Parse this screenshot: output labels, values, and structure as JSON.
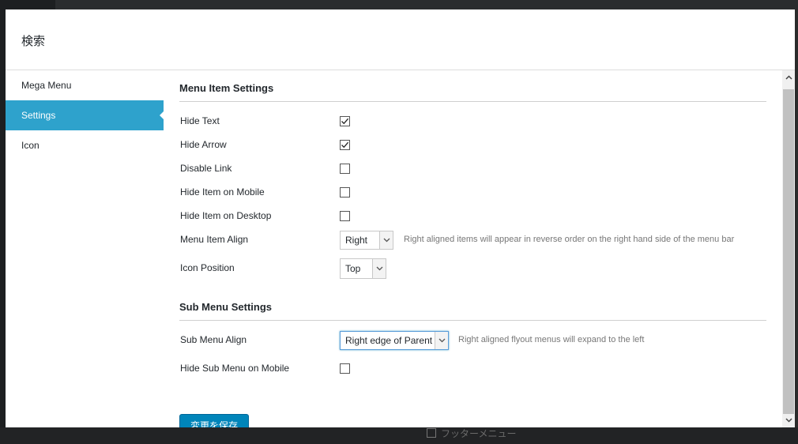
{
  "modal": {
    "title": "検索"
  },
  "sidebar": {
    "items": [
      {
        "label": "Mega Menu",
        "active": false
      },
      {
        "label": "Settings",
        "active": true
      },
      {
        "label": "Icon",
        "active": false
      }
    ]
  },
  "menu_item_settings": {
    "title": "Menu Item Settings",
    "hide_text": {
      "label": "Hide Text",
      "checked": true
    },
    "hide_arrow": {
      "label": "Hide Arrow",
      "checked": true
    },
    "disable_link": {
      "label": "Disable Link",
      "checked": false
    },
    "hide_item_mobile": {
      "label": "Hide Item on Mobile",
      "checked": false
    },
    "hide_item_desktop": {
      "label": "Hide Item on Desktop",
      "checked": false
    },
    "menu_item_align": {
      "label": "Menu Item Align",
      "value": "Right",
      "hint": "Right aligned items will appear in reverse order on the right hand side of the menu bar"
    },
    "icon_position": {
      "label": "Icon Position",
      "value": "Top"
    }
  },
  "sub_menu_settings": {
    "title": "Sub Menu Settings",
    "sub_menu_align": {
      "label": "Sub Menu Align",
      "value": "Right edge of Parent",
      "hint": "Right aligned flyout menus will expand to the left"
    },
    "hide_sub_menu_mobile": {
      "label": "Hide Sub Menu on Mobile",
      "checked": false
    }
  },
  "actions": {
    "save_label": "変更を保存"
  },
  "background": {
    "footer_menu_label": "フッターメニュー"
  },
  "colors": {
    "accent": "#2ea2cc",
    "primary_button": "#0085ba"
  }
}
